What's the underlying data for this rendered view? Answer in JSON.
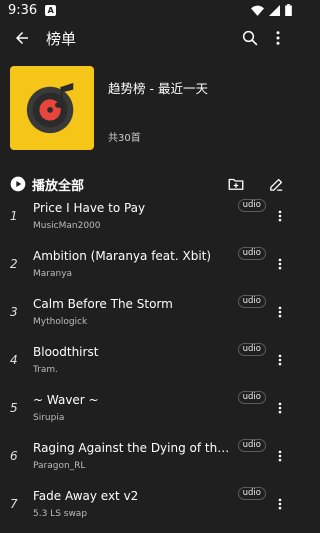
{
  "status": {
    "time": "9:36",
    "badge_letter": "A"
  },
  "app_bar": {
    "title": "榜单"
  },
  "playlist": {
    "name": "趋势榜 - 最近一天",
    "count": "共30首"
  },
  "actions": {
    "play_all": "播放全部"
  },
  "tracks": [
    {
      "num": "1",
      "title": "Price I Have to Pay",
      "artist": "MusicMan2000",
      "source": "udio"
    },
    {
      "num": "2",
      "title": "Ambition (Maranya feat. Xbit)",
      "artist": "Maranya",
      "source": "udio"
    },
    {
      "num": "3",
      "title": "Calm Before The Storm",
      "artist": "Mythologick",
      "source": "udio"
    },
    {
      "num": "4",
      "title": "Bloodthirst",
      "artist": "Tram.",
      "source": "udio"
    },
    {
      "num": "5",
      "title": "~ Waver ~",
      "artist": "Sirupia",
      "source": "udio"
    },
    {
      "num": "6",
      "title": "Raging Against the Dying of the Light",
      "artist": "Paragon_RL",
      "source": "udio"
    },
    {
      "num": "7",
      "title": "Fade Away ext v2",
      "artist": "5.3 LS swap",
      "source": "udio"
    }
  ],
  "colors": {
    "background": "#1f1f1f",
    "cover": "#f5c518",
    "text": "#ffffff",
    "secondary_text": "#bbbbbb"
  }
}
